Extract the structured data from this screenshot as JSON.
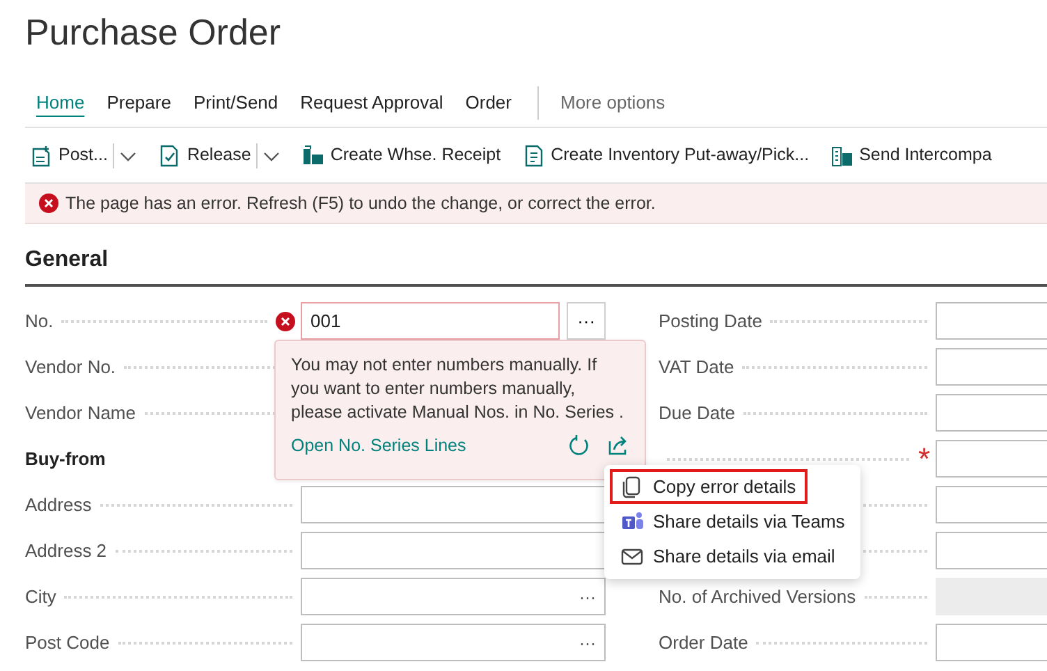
{
  "page": {
    "title": "Purchase Order"
  },
  "tabs": [
    {
      "label": "Home",
      "selected": true
    },
    {
      "label": "Prepare",
      "selected": false
    },
    {
      "label": "Print/Send",
      "selected": false
    },
    {
      "label": "Request Approval",
      "selected": false
    },
    {
      "label": "Order",
      "selected": false
    }
  ],
  "more_options": "More options",
  "actions": [
    {
      "label": "Post...",
      "dropdown": true
    },
    {
      "label": "Release",
      "dropdown": true
    },
    {
      "label": "Create Whse. Receipt",
      "dropdown": false
    },
    {
      "label": "Create Inventory Put-away/Pick...",
      "dropdown": false
    },
    {
      "label": "Send Intercompa",
      "dropdown": false
    }
  ],
  "error_bar": {
    "message": "The page has an error. Refresh (F5) to undo the change, or correct the error."
  },
  "section": {
    "title": "General"
  },
  "left_fields": [
    {
      "kind": "button_lookup",
      "label": "No.",
      "value": "001",
      "error": true,
      "lookup_text": "···"
    },
    {
      "kind": "field",
      "label": "Vendor No."
    },
    {
      "kind": "field",
      "label": "Vendor Name"
    },
    {
      "kind": "heading",
      "label": "Buy-from"
    },
    {
      "kind": "field",
      "label": "Address",
      "error": false
    },
    {
      "kind": "field",
      "label": "Address 2",
      "error": false
    },
    {
      "kind": "field",
      "label": "City",
      "error": false,
      "lookup_text": "···"
    },
    {
      "kind": "field",
      "label": "Post Code",
      "error": false,
      "lookup_text": "···"
    }
  ],
  "right_fields": [
    {
      "label": "Posting Date",
      "required": false,
      "disabled": false
    },
    {
      "label": "VAT Date",
      "required": false,
      "disabled": false
    },
    {
      "label": "Due Date",
      "required": false,
      "disabled": false
    },
    {
      "required": true,
      "disabled": false
    },
    {
      "required": false,
      "disabled": false
    },
    {
      "required": false,
      "disabled": false
    },
    {
      "label": "No. of Archived Versions",
      "required": false,
      "disabled": true
    },
    {
      "label": "Order Date",
      "required": false,
      "disabled": false
    }
  ],
  "required_mark": "*",
  "error_popup": {
    "message": "You may not enter numbers manually. If you want to enter numbers manually, please activate Manual Nos. in No. Series .",
    "link": "Open No. Series Lines"
  },
  "share_menu": [
    {
      "label": "Copy error details",
      "highlighted": true
    },
    {
      "label": "Share details via Teams",
      "highlighted": false
    },
    {
      "label": "Share details via email",
      "highlighted": false
    }
  ]
}
